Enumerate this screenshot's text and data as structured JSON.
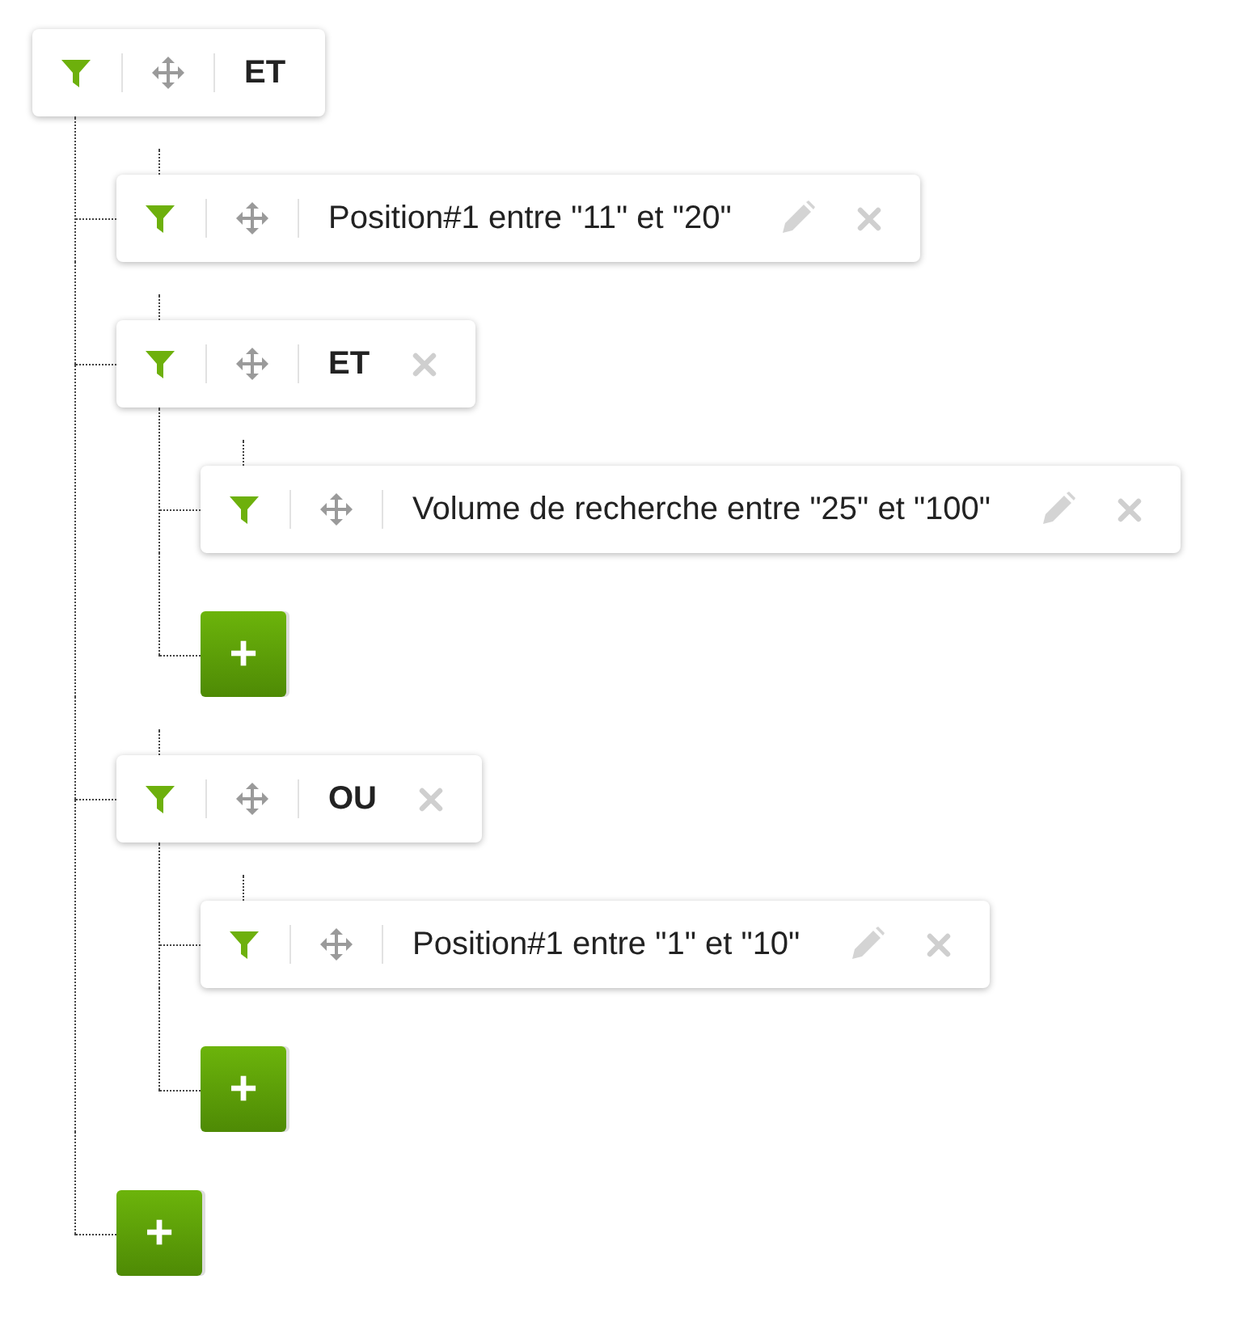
{
  "root": {
    "kind": "group",
    "label": "ET",
    "removable": false,
    "add_button": "+",
    "children": [
      {
        "kind": "rule",
        "label": "Position#1 entre \"11\" et \"20\"",
        "removable": true
      },
      {
        "kind": "group",
        "label": "ET",
        "removable": true,
        "add_button": "+",
        "children": [
          {
            "kind": "rule",
            "label": "Volume de recherche entre \"25\" et \"100\"",
            "removable": true
          }
        ]
      },
      {
        "kind": "group",
        "label": "OU",
        "removable": true,
        "add_button": "+",
        "children": [
          {
            "kind": "rule",
            "label": "Position#1 entre \"1\" et \"10\"",
            "removable": true
          }
        ]
      }
    ]
  }
}
